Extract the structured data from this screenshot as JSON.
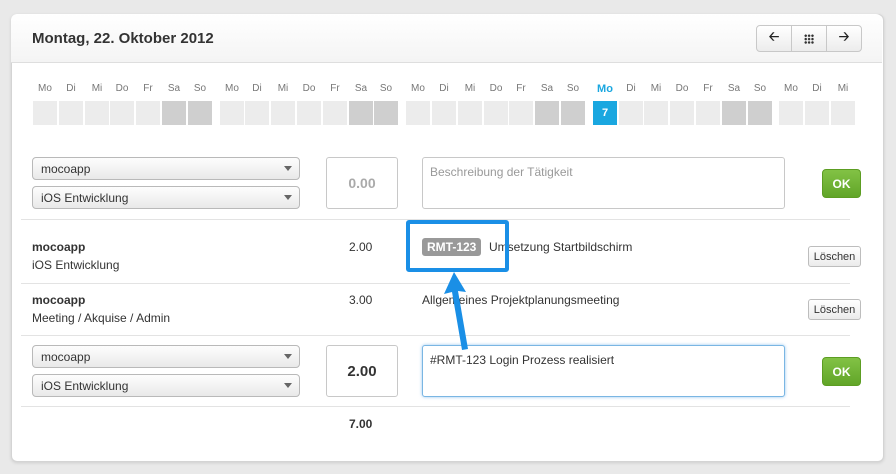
{
  "header": {
    "title": "Montag, 22. Oktober 2012",
    "nav": {
      "prev_icon": "arrow-left-icon",
      "grid_icon": "grid-icon",
      "next_icon": "arrow-right-icon"
    }
  },
  "week_strip": {
    "labels": [
      "Mo",
      "Di",
      "Mi",
      "Do",
      "Fr",
      "Sa",
      "So",
      "Mo",
      "Di",
      "Mi",
      "Do",
      "Fr",
      "Sa",
      "So",
      "Mo",
      "Di",
      "Mi",
      "Do",
      "Fr",
      "Sa",
      "So",
      "Mo",
      "Di",
      "Mi",
      "Do",
      "Fr",
      "Sa",
      "So",
      "Mo",
      "Di",
      "Mi"
    ],
    "today_index": 21,
    "today_day": "7",
    "colors": {
      "today": "#1aa7e0",
      "weekend": "#cfcfcf",
      "weekday": "#ececec"
    }
  },
  "new_entry_top": {
    "project": "mocoapp",
    "task": "iOS Entwicklung",
    "hours": "0.00",
    "description_placeholder": "Beschreibung der Tätigkeit",
    "ok_label": "OK"
  },
  "entries": [
    {
      "project": "mocoapp",
      "task": "iOS Entwicklung",
      "hours": "2.00",
      "tag": "RMT-123",
      "description": "Umsetzung Startbildschirm",
      "delete_label": "Löschen"
    },
    {
      "project": "mocoapp",
      "task": "Meeting / Akquise / Admin",
      "hours": "3.00",
      "description": "Allgemeines Projektplanungsmeeting",
      "delete_label": "Löschen"
    }
  ],
  "new_entry_bottom": {
    "project": "mocoapp",
    "task": "iOS Entwicklung",
    "hours": "2.00",
    "description": "#RMT-123 Login Prozess realisiert",
    "ok_label": "OK"
  },
  "total": "7.00",
  "colors": {
    "accent": "#1a8fe6",
    "ok_green": "#6aae2e",
    "tag_gray": "#999999"
  }
}
